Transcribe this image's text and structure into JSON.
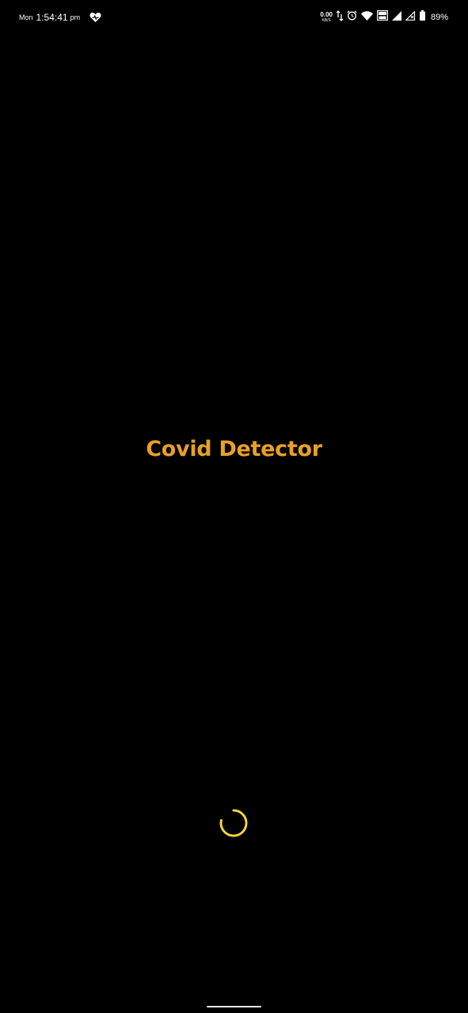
{
  "status_bar": {
    "day": "Mon",
    "time": "1:54:41",
    "ampm": "pm",
    "net_speed_value": "0.00",
    "net_speed_unit": "KB/S",
    "battery_percent": "89%",
    "icons": [
      "heart-icon",
      "data-arrows-icon",
      "alarm-icon",
      "wifi-icon",
      "volte-icon",
      "signal-icon",
      "signal-no-service-icon",
      "battery-icon"
    ]
  },
  "app": {
    "title": "Covid Detector",
    "title_color": "#e8a026",
    "spinner_color": "#f1d63a"
  }
}
